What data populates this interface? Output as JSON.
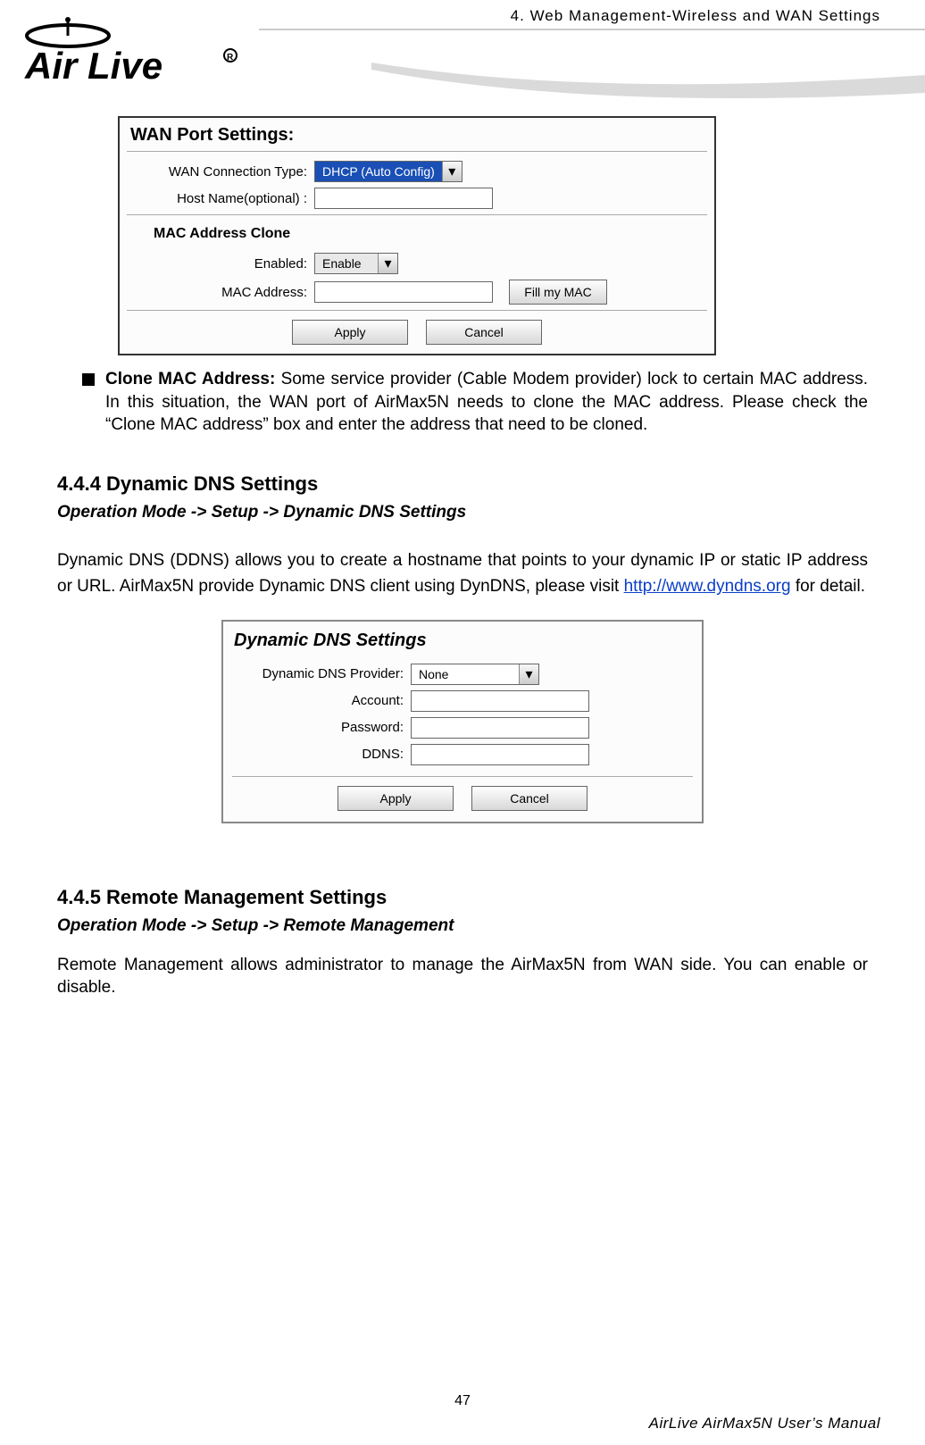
{
  "header": {
    "chapter": "4. Web Management-Wireless and WAN Settings"
  },
  "wan_panel": {
    "title": "WAN Port Settings:",
    "conn_type_label": "WAN Connection Type:",
    "conn_type_value": "DHCP (Auto Config)",
    "host_name_label": "Host Name(optional) :",
    "mac_clone_title": "MAC Address Clone",
    "enabled_label": "Enabled:",
    "enabled_value": "Enable",
    "mac_addr_label": "MAC Address:",
    "fill_mac_btn": "Fill my MAC",
    "apply_btn": "Apply",
    "cancel_btn": "Cancel"
  },
  "clone_para": {
    "lead": "Clone MAC Address:",
    "rest": " Some service provider (Cable Modem provider) lock to certain MAC address. In this situation, the WAN port of AirMax5N needs to clone the MAC address. Please check the “Clone MAC address” box and enter the address that need to be cloned."
  },
  "ddns": {
    "heading": "4.4.4 Dynamic DNS Settings",
    "breadcrumb": "Operation Mode -> Setup -> Dynamic DNS Settings",
    "para_pre": "Dynamic DNS (DDNS) allows you to create a hostname that points to your dynamic IP or static IP address or URL. AirMax5N provide Dynamic DNS client using DynDNS, please visit ",
    "link_text": "http://www.dyndns.org",
    "para_post": " for detail.",
    "panel_title": "Dynamic DNS Settings",
    "provider_label": "Dynamic DNS Provider:",
    "provider_value": "None",
    "account_label": "Account:",
    "password_label": "Password:",
    "ddns_label": "DDNS:",
    "apply_btn": "Apply",
    "cancel_btn": "Cancel"
  },
  "remote": {
    "heading": "4.4.5 Remote Management Settings",
    "breadcrumb": "Operation Mode -> Setup -> Remote Management",
    "para": "Remote Management allows administrator to manage the AirMax5N from WAN side. You can enable or disable."
  },
  "footer": {
    "page": "47",
    "manual": "AirLive AirMax5N User’s Manual"
  }
}
